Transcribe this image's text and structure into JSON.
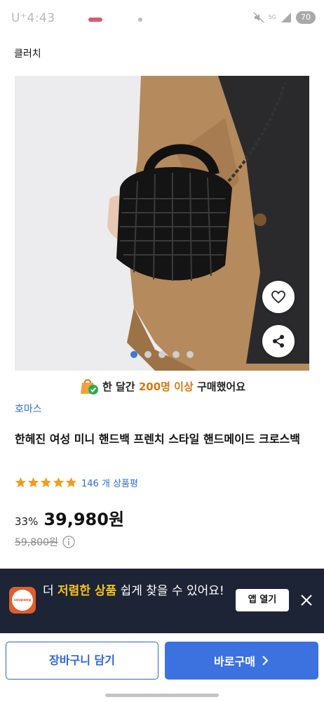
{
  "status_bar": {
    "carrier_time": "U⁺4:43",
    "network": "5G",
    "battery": "70"
  },
  "page": {
    "title": "클러치"
  },
  "product": {
    "image_alt": "black woven mini handbag",
    "carousel": {
      "count": 5,
      "active": 1
    },
    "purchase_banner": {
      "prefix": "한 달간 ",
      "highlight": "200명 이상",
      "suffix": " 구매했어요"
    },
    "brand": "호마스",
    "title": "한헤진 여성 미니 핸드백 프렌치 스타일 핸드메이드 크로스백",
    "rating": {
      "stars": 5,
      "review_count": "146 개 상품평"
    },
    "discount": "33%",
    "price": "39,980원",
    "original_price": "59,800원"
  },
  "app_banner": {
    "logo_text": "coupang",
    "text_prefix": "더 ",
    "text_highlight": "저렴한 상품",
    "text_suffix": " 쉽게 찾을 수 있어요!",
    "open_label": "앱 열기"
  },
  "bottom": {
    "cart_label": "장바구니 담기",
    "buy_label": "바로구매"
  },
  "colors": {
    "accent": "#3b72e0",
    "brand_link": "#2a6ec4",
    "banner_bg": "#1c2436",
    "highlight": "#f5c218",
    "star": "#f39c1e"
  }
}
